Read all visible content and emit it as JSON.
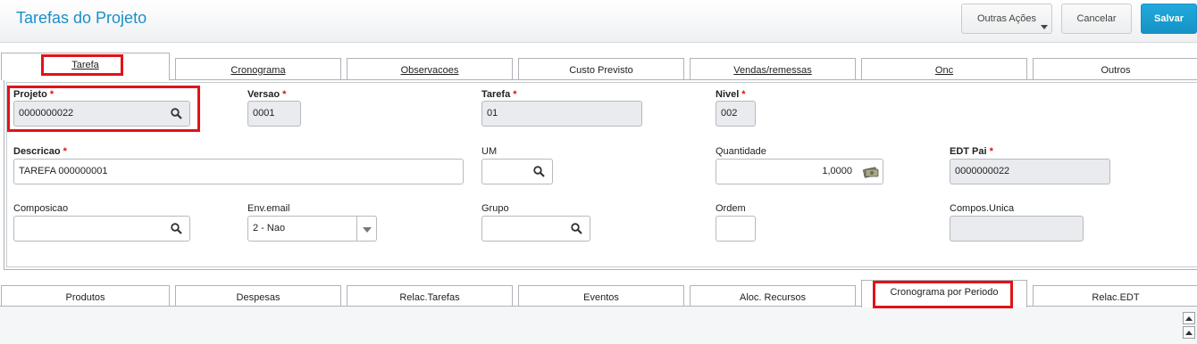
{
  "header": {
    "title": "Tarefas do Projeto",
    "outras_acoes": "Outras Ações",
    "cancelar": "Cancelar",
    "salvar": "Salvar"
  },
  "top_tabs": [
    "Tarefa",
    "Cronograma",
    "Observacoes",
    "Custo Previsto",
    "Vendas/remessas",
    "Onc",
    "Outros"
  ],
  "form": {
    "projeto": {
      "label": "Projeto",
      "value": "0000000022"
    },
    "versao": {
      "label": "Versao",
      "value": "0001"
    },
    "tarefa": {
      "label": "Tarefa",
      "value": "01"
    },
    "nivel": {
      "label": "Nivel",
      "value": "002"
    },
    "descricao": {
      "label": "Descricao",
      "value": "TAREFA 000000001"
    },
    "um": {
      "label": "UM",
      "value": ""
    },
    "quantidade": {
      "label": "Quantidade",
      "value": "1,0000"
    },
    "edt_pai": {
      "label": "EDT Pai",
      "value": "0000000022"
    },
    "composicao": {
      "label": "Composicao",
      "value": ""
    },
    "env_email": {
      "label": "Env.email",
      "value": "2 - Nao"
    },
    "grupo": {
      "label": "Grupo",
      "value": ""
    },
    "ordem": {
      "label": "Ordem",
      "value": ""
    },
    "compos_unica": {
      "label": "Compos.Unica",
      "value": ""
    },
    "required_mark": "*"
  },
  "bottom_tabs": [
    "Produtos",
    "Despesas",
    "Relac.Tarefas",
    "Eventos",
    "Aloc. Recursos",
    "Cronograma por Periodo",
    "Relac.EDT"
  ],
  "colors": {
    "accent": "#1a8fc9",
    "highlight": "#e0131a",
    "readonly": "#e9ebee"
  }
}
